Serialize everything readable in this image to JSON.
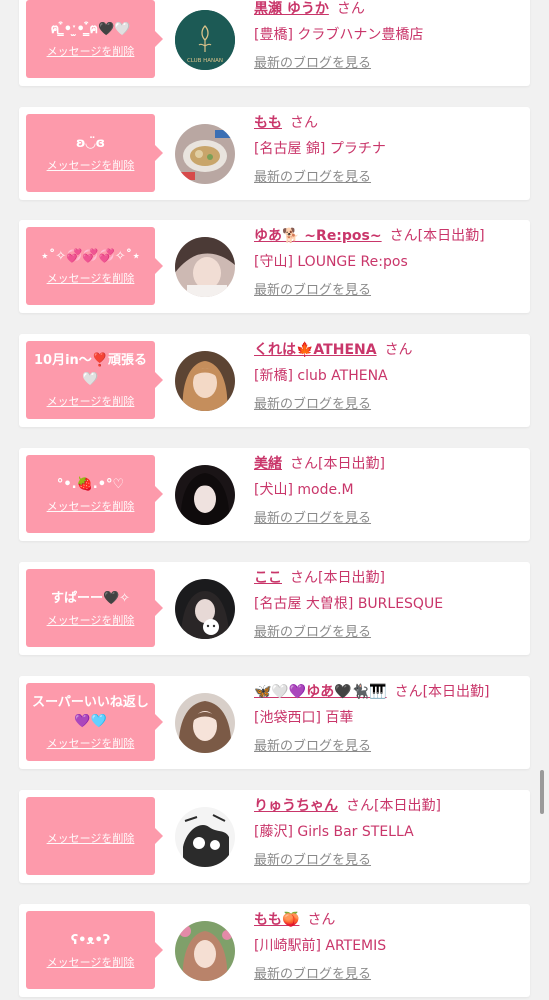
{
  "delete_label": "メッセージを削除",
  "blog_label": "最新のブログを見る",
  "san_label": "さん",
  "accent_color": "#fd9aab",
  "name_color": "#c9366a",
  "items": [
    {
      "message": "ฅ ̳͒•ˑ̫• ̳͒ฅ🖤🤍",
      "name": "黒瀬 ゆうか",
      "shift": "",
      "shop": "[豊橋] クラブハナン豊橋店",
      "avatar_icon": "shop-logo-icon",
      "avatar_text": "CLUB HANAN"
    },
    {
      "message": "ʚ◡̈ɞ",
      "name": "もも",
      "shift": "",
      "shop": "[名古屋 錦] プラチナ",
      "avatar_icon": "food-photo-icon",
      "avatar_text": ""
    },
    {
      "message": "⋆˚✧💞💞💞✧˚⋆",
      "name": "ゆあ🐕 ~Re:pos~",
      "shift": "[本日出勤]",
      "shop": "[守山] LOUNGE Re:pos",
      "avatar_icon": "profile-photo-icon",
      "avatar_text": ""
    },
    {
      "message": "10月in〜❣️頑張る🤍",
      "name": "くれは🍁ATHENA",
      "shift": "",
      "shop": "[新橋] club ATHENA",
      "avatar_icon": "profile-photo-icon",
      "avatar_text": ""
    },
    {
      "message": "°•.🍓.•°♡",
      "name": "美緒",
      "shift": "[本日出勤]",
      "shop": "[犬山] mode.M",
      "avatar_icon": "profile-photo-icon",
      "avatar_text": ""
    },
    {
      "message": "すぱーー🖤✧",
      "name": "ここ",
      "shift": "[本日出勤]",
      "shop": "[名古屋 大曽根] BURLESQUE",
      "avatar_icon": "profile-photo-icon",
      "avatar_text": ""
    },
    {
      "message": "スーパーいいね返し💜🩵",
      "name": "🦋🤍💜ゆあ🖤🐈‍⬛🎹",
      "shift": "[本日出勤]",
      "shop": "[池袋西口] 百華",
      "avatar_icon": "profile-photo-icon",
      "avatar_text": ""
    },
    {
      "message": "",
      "name": "りゅうちゃん",
      "shift": "[本日出勤]",
      "shop": "[藤沢] Girls Bar STELLA",
      "avatar_icon": "manga-art-icon",
      "avatar_text": ""
    },
    {
      "message": "ʕ•ᴥ•ʔ",
      "name": "もも🍑",
      "shift": "",
      "shop": "[川崎駅前] ARTEMIS",
      "avatar_icon": "profile-photo-icon",
      "avatar_text": ""
    }
  ]
}
